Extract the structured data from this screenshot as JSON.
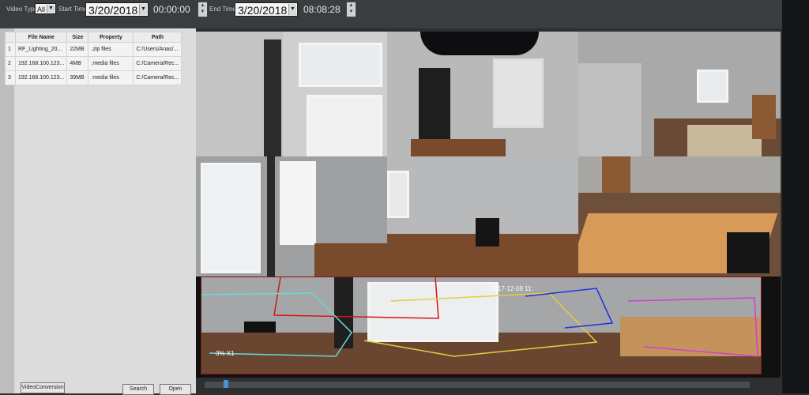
{
  "toolbar": {
    "video_type_label": "Video Type",
    "video_type_value": "All",
    "start_time_label": "Start Time",
    "start_date": "3/20/2018",
    "start_time": "00:00:00",
    "end_time_label": "End Time",
    "end_date": "3/20/2018",
    "end_time": "08:08:28"
  },
  "file_table": {
    "headers": [
      "File Name",
      "Size",
      "Property",
      "Path"
    ],
    "rows": [
      {
        "index": "1",
        "name": "RF_Lighting_20...",
        "size": "22MB",
        "property": ".zip files",
        "path": "C:/Users/Anas/..."
      },
      {
        "index": "2",
        "name": "192.168.100.123...",
        "size": "4MB",
        "property": ".media files",
        "path": "C:/Camera/Rec..."
      },
      {
        "index": "3",
        "name": "192.168.100.123...",
        "size": "39MB",
        "property": ".media files",
        "path": "C:/Camera/Rec..."
      }
    ]
  },
  "buttons": {
    "video_conversion": "VideoConversion",
    "search": "Search",
    "open": "Open"
  },
  "video": {
    "panorama_timestamp": "2017-12-09 11:",
    "zoom_label": "3% X1"
  },
  "colors": {
    "toolbar_bg": "#3a3d40",
    "panel_bg": "#dcdcdc",
    "accent_blue": "#4a8fd8"
  }
}
